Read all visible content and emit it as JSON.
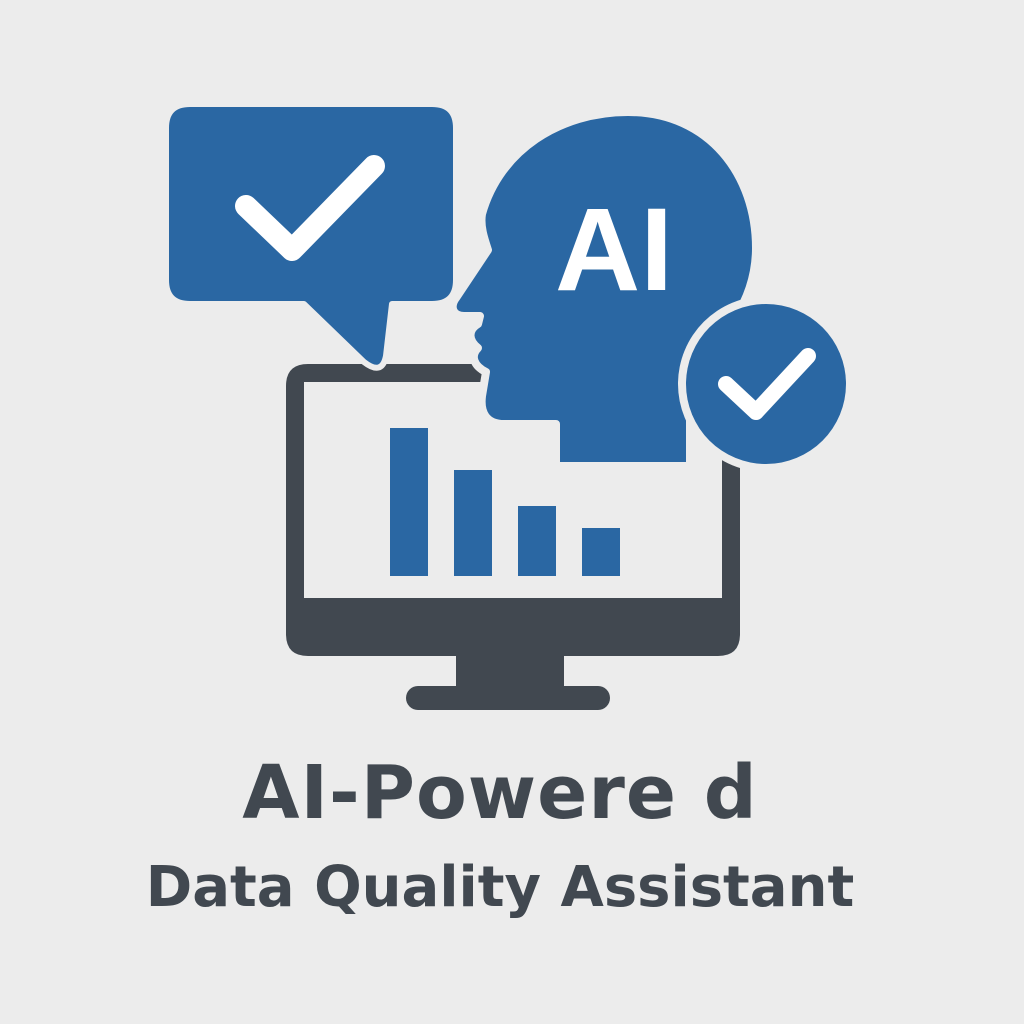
{
  "logo": {
    "badge_text": "AI",
    "title_line_1": "AI-Powere d",
    "title_line_2": "Data Quality Assistant"
  },
  "icons": {
    "speech_bubble": "speech-bubble-check-icon",
    "head": "ai-head-icon",
    "badge": "check-circle-icon",
    "monitor": "monitor-bar-chart-icon"
  },
  "colors": {
    "background": "#ececec",
    "brand_blue": "#2a67a3",
    "dark_gray": "#414850",
    "white": "#ffffff"
  }
}
